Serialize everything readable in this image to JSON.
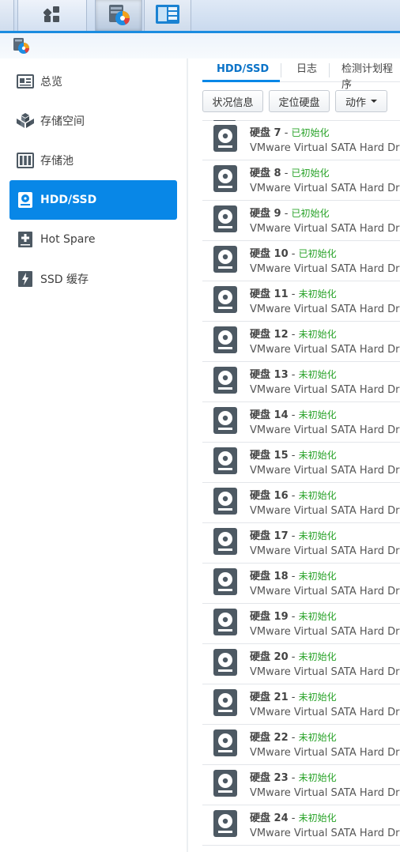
{
  "taskbar": {
    "buttons": [
      {
        "icon": "apps-grid-icon"
      },
      {
        "icon": "storage-manager-icon"
      },
      {
        "icon": "control-panel-icon"
      }
    ]
  },
  "window": {
    "icon": "storage-manager-icon"
  },
  "sidebar": {
    "items": [
      {
        "label": "总览",
        "icon": "overview-icon"
      },
      {
        "label": "存储空间",
        "icon": "volume-cubes-icon"
      },
      {
        "label": "存储池",
        "icon": "storage-pool-icon"
      },
      {
        "label": "HDD/SSD",
        "icon": "hdd-icon",
        "active": true
      },
      {
        "label": "Hot Spare",
        "icon": "hot-spare-plus-icon"
      },
      {
        "label": "SSD 缓存",
        "icon": "ssd-cache-bolt-icon"
      }
    ]
  },
  "tabs": [
    {
      "label": "HDD/SSD",
      "active": true
    },
    {
      "label": "日志"
    },
    {
      "label": "检测计划程序"
    }
  ],
  "toolbar": {
    "status_info": "状况信息",
    "locate_disk": "定位硬盘",
    "action": "动作"
  },
  "colors": {
    "accent": "#0887e7",
    "status_green": "#29a329"
  },
  "disks": [
    {
      "name": "硬盘 7",
      "status": "已初始化",
      "model": "VMware Virtual SATA Hard Drive"
    },
    {
      "name": "硬盘 8",
      "status": "已初始化",
      "model": "VMware Virtual SATA Hard Drive"
    },
    {
      "name": "硬盘 9",
      "status": "已初始化",
      "model": "VMware Virtual SATA Hard Drive"
    },
    {
      "name": "硬盘 10",
      "status": "已初始化",
      "model": "VMware Virtual SATA Hard Drive"
    },
    {
      "name": "硬盘 11",
      "status": "未初始化",
      "model": "VMware Virtual SATA Hard Drive"
    },
    {
      "name": "硬盘 12",
      "status": "未初始化",
      "model": "VMware Virtual SATA Hard Drive"
    },
    {
      "name": "硬盘 13",
      "status": "未初始化",
      "model": "VMware Virtual SATA Hard Drive"
    },
    {
      "name": "硬盘 14",
      "status": "未初始化",
      "model": "VMware Virtual SATA Hard Drive"
    },
    {
      "name": "硬盘 15",
      "status": "未初始化",
      "model": "VMware Virtual SATA Hard Drive"
    },
    {
      "name": "硬盘 16",
      "status": "未初始化",
      "model": "VMware Virtual SATA Hard Drive"
    },
    {
      "name": "硬盘 17",
      "status": "未初始化",
      "model": "VMware Virtual SATA Hard Drive"
    },
    {
      "name": "硬盘 18",
      "status": "未初始化",
      "model": "VMware Virtual SATA Hard Drive"
    },
    {
      "name": "硬盘 19",
      "status": "未初始化",
      "model": "VMware Virtual SATA Hard Drive"
    },
    {
      "name": "硬盘 20",
      "status": "未初始化",
      "model": "VMware Virtual SATA Hard Drive"
    },
    {
      "name": "硬盘 21",
      "status": "未初始化",
      "model": "VMware Virtual SATA Hard Drive"
    },
    {
      "name": "硬盘 22",
      "status": "未初始化",
      "model": "VMware Virtual SATA Hard Drive"
    },
    {
      "name": "硬盘 23",
      "status": "未初始化",
      "model": "VMware Virtual SATA Hard Drive"
    },
    {
      "name": "硬盘 24",
      "status": "未初始化",
      "model": "VMware Virtual SATA Hard Drive"
    }
  ]
}
